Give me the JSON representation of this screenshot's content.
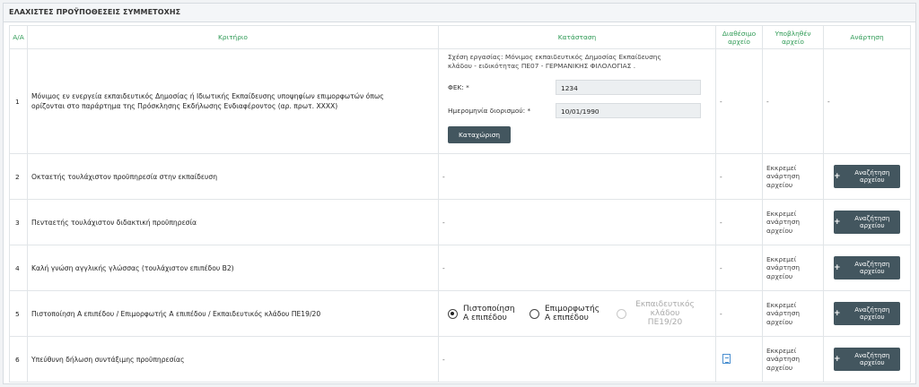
{
  "panel": {
    "title": "ΕΛΑΧΙΣΤΕΣ ΠΡΟΫΠΟΘΕΣΕΙΣ ΣΥΜΜΕΤΟΧΗΣ"
  },
  "columns": {
    "aa": "Α/Α",
    "criterion": "Κριτήριο",
    "status": "Κατάσταση",
    "available": "Διαθέσιμο αρχείο",
    "submitted": "Υποβληθέν αρχείο",
    "upload": "Ανάρτηση"
  },
  "rows": [
    {
      "num": "1",
      "criterion": "Μόνιμος εν ενεργεία εκπαιδευτικός Δημοσίας ή Ιδιωτικής Εκπαίδευσης υποψηφίων επιμορφωτών όπως ορίζονται στο παράρτημα της Πρόσκλησης Εκδήλωσης Ενδιαφέροντος (αρ. πρωτ. ΧΧΧΧ)",
      "form": {
        "relation": "Σχέση εργασίας: Μόνιμος εκπαιδευτικός Δημοσίας Εκπαίδευσης κλάδου - ειδικότητας ΠΕ07 - ΓΕΡΜΑΝΙΚΗΣ ΦΙΛΟΛΟΓΙΑΣ .",
        "fek_label": "ΦΕΚ:  *",
        "fek_value": "1234",
        "date_label": "Ημερομηνία διορισμού:  *",
        "date_value": "10/01/1990",
        "save_label": "Καταχώριση"
      },
      "available": "-",
      "submitted": "-",
      "upload": "-"
    },
    {
      "num": "2",
      "criterion": "Οκταετής τουλάχιστον προϋπηρεσία στην εκπαίδευση",
      "status": "-",
      "available": "-",
      "submitted": "Εκκρεμεί ανάρτηση αρχείου",
      "upload_label": "Αναζήτηση αρχείου"
    },
    {
      "num": "3",
      "criterion": "Πενταετής τουλάχιστον διδακτική προϋπηρεσία",
      "status": "-",
      "available": "-",
      "submitted": "Εκκρεμεί ανάρτηση αρχείου",
      "upload_label": "Αναζήτηση αρχείου"
    },
    {
      "num": "4",
      "criterion": "Καλή γνώση αγγλικής γλώσσας (τουλάχιστον επιπέδου Β2)",
      "status": "-",
      "available": "-",
      "submitted": "Εκκρεμεί ανάρτηση αρχείου",
      "upload_label": "Αναζήτηση αρχείου"
    },
    {
      "num": "5",
      "criterion": "Πιστοποίηση Α επιπέδου / Επιμορφωτής Α επιπέδου / Εκπαιδευτικός κλάδου ΠΕ19/20",
      "radios": [
        "Πιστοποίηση Α επιπέδου",
        "Επιμορφωτής Α επιπέδου",
        "Εκπαιδευτικός κλάδου ΠΕ19/20"
      ],
      "available": "-",
      "submitted": "Εκκρεμεί ανάρτηση αρχείου",
      "upload_label": "Αναζήτηση αρχείου"
    },
    {
      "num": "6",
      "criterion": "Υπεύθυνη δήλωση συντάξιμης προϋπηρεσίας",
      "status": "-",
      "available_icon": "pdf-file-icon",
      "submitted": "Εκκρεμεί ανάρτηση αρχείου",
      "upload_label": "Αναζήτηση αρχείου"
    }
  ],
  "upload_plus": "+",
  "colors": {
    "header_green": "#2e9a55",
    "button_dark": "#43565f",
    "pdf_blue": "#4a8fd0"
  }
}
